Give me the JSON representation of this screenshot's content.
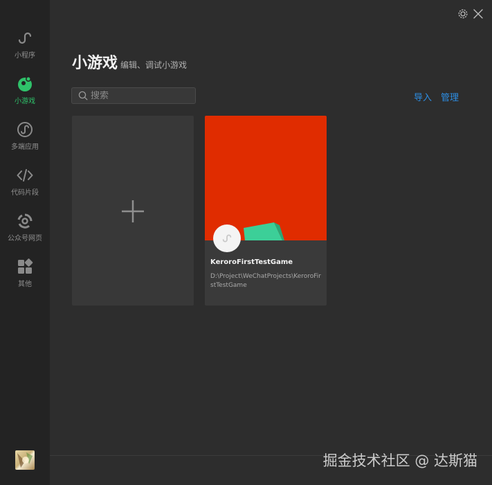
{
  "sidebar": {
    "items": [
      {
        "label": "小程序",
        "icon": "mini-program-icon",
        "active": false
      },
      {
        "label": "小游戏",
        "icon": "mini-game-icon",
        "active": true
      },
      {
        "label": "多端应用",
        "icon": "multi-platform-icon",
        "active": false
      },
      {
        "label": "代码片段",
        "icon": "code-snippet-icon",
        "active": false
      },
      {
        "label": "公众号网页",
        "icon": "official-account-icon",
        "active": false
      },
      {
        "label": "其他",
        "icon": "other-icon",
        "active": false
      }
    ],
    "active_color": "#2fc26a"
  },
  "header": {
    "title": "小游戏",
    "subtitle": "编辑、调试小游戏"
  },
  "search": {
    "placeholder": "搜索",
    "value": ""
  },
  "actions": {
    "import_label": "导入",
    "manage_label": "管理",
    "link_color": "#2d8ee4"
  },
  "projects": [
    {
      "name": "KeroroFirstTestGame",
      "path": "D:\\Project\\WeChatProjects\\KeroroFirstTestGame",
      "cover_color": "#e02c00"
    }
  ],
  "watermark": "掘金技术社区 @ 达斯猫"
}
